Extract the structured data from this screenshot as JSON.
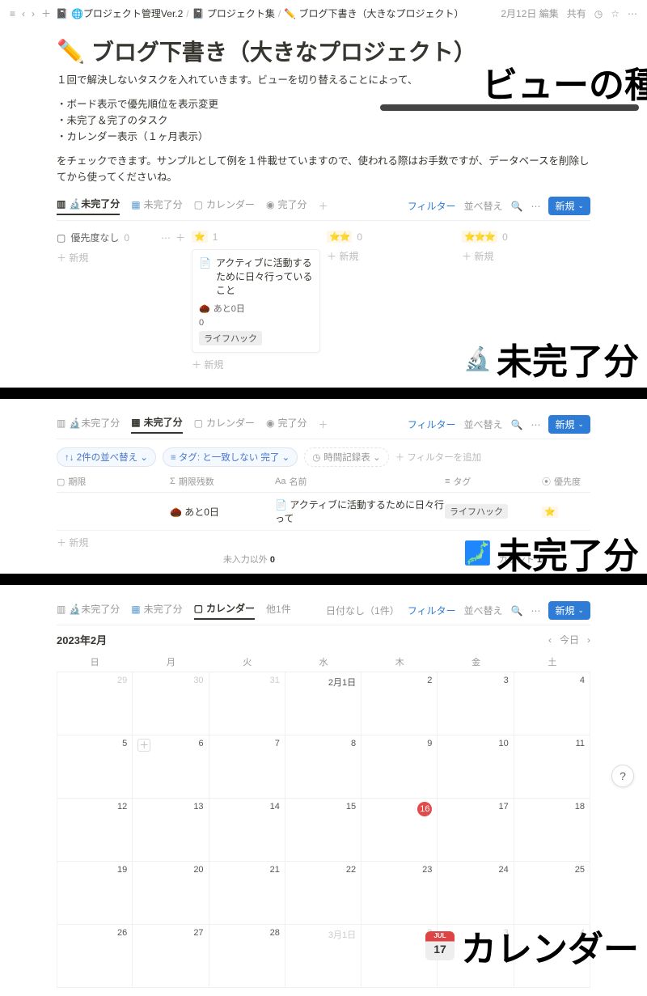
{
  "topbar": {
    "breadcrumb": [
      "🌐プロジェクト管理Ver.2",
      "📓 プロジェクト集",
      "✏️ ブログ下書き（大きなプロジェクト）"
    ],
    "sep": "/",
    "edited": "2月12日 編集",
    "share": "共有"
  },
  "page": {
    "icon": "✏️",
    "title": "ブログ下書き（大きなプロジェクト）",
    "desc": "１回で解決しないタスクを入れていきます。ビューを切り替えることによって、",
    "bullets": [
      "・ボード表示で優先順位を表示変更",
      "・未完了＆完了のタスク",
      "・カレンダー表示（１ヶ月表示）"
    ],
    "desc2": "をチェックできます。サンプルとして例を１件載せていますので、使われる際はお手数ですが、データベースを削除してから使ってくださいね。"
  },
  "annotations": {
    "a1": "ビューの種類",
    "a2": "未完了分",
    "a3": "未完了分",
    "a4": "カレンダー"
  },
  "views": {
    "filter": "フィルター",
    "sort": "並べ替え",
    "new": "新規",
    "add_filter": "＋ フィルターを追加",
    "no_date": "日付なし（1件）"
  },
  "tabs1": [
    "🔬未完了分",
    "未完了分",
    "カレンダー",
    "完了分"
  ],
  "board": {
    "cols": [
      {
        "icon": "▢",
        "label": "優先度なし",
        "count": "0",
        "has_menu": true
      },
      {
        "icon": "⭐",
        "label": "",
        "count": "1"
      },
      {
        "icon": "⭐⭐",
        "label": "",
        "count": "0"
      },
      {
        "icon": "⭐⭐⭐",
        "label": "",
        "count": "0"
      }
    ],
    "card": {
      "title": "アクティブに活動するために日々行っていること",
      "remain": "あと0日",
      "count0": "0",
      "tag": "ライフハック"
    },
    "add": "＋ 新規"
  },
  "tabs2": [
    "🔬未完了分",
    "未完了分",
    "カレンダー",
    "完了分"
  ],
  "filters2": {
    "sort": "↑↓ 2件の並べ替え ⌄",
    "tag": "≡ タグ: と一致しない 完了 ⌄",
    "time": "時間記録表 ⌄"
  },
  "table": {
    "headers": [
      "期限",
      "期限残数",
      "名前",
      "タグ",
      "優先度"
    ],
    "row": {
      "remain": "あと0日",
      "name": "アクティブに活動するために日々行って",
      "tag": "ライフハック"
    },
    "add": "＋ 新規",
    "footer_left": "未入力以外",
    "footer_left_n": "0",
    "footer_right": "カウント",
    "footer_right_n": "1"
  },
  "tabs3": [
    "🔬未完了分",
    "未完了分",
    "カレンダー",
    "他1件"
  ],
  "calendar": {
    "title": "2023年2月",
    "today": "今日",
    "weekdays": [
      "日",
      "月",
      "火",
      "水",
      "木",
      "金",
      "土"
    ],
    "cells": [
      {
        "n": "29",
        "dim": true
      },
      {
        "n": "30",
        "dim": true
      },
      {
        "n": "31",
        "dim": true
      },
      {
        "n": "2月1日"
      },
      {
        "n": "2"
      },
      {
        "n": "3"
      },
      {
        "n": "4"
      },
      {
        "n": "5"
      },
      {
        "n": "6",
        "plus": true
      },
      {
        "n": "7"
      },
      {
        "n": "8"
      },
      {
        "n": "9"
      },
      {
        "n": "10"
      },
      {
        "n": "11"
      },
      {
        "n": "12"
      },
      {
        "n": "13"
      },
      {
        "n": "14"
      },
      {
        "n": "15"
      },
      {
        "n": "16",
        "today": true
      },
      {
        "n": "17"
      },
      {
        "n": "18"
      },
      {
        "n": "19"
      },
      {
        "n": "20"
      },
      {
        "n": "21"
      },
      {
        "n": "22"
      },
      {
        "n": "23"
      },
      {
        "n": "24"
      },
      {
        "n": "25"
      },
      {
        "n": "26"
      },
      {
        "n": "27"
      },
      {
        "n": "28"
      },
      {
        "n": "3月1日",
        "dim": true
      },
      {
        "n": "2",
        "dim": true
      },
      {
        "n": "3",
        "dim": true
      },
      {
        "n": "4",
        "dim": true
      }
    ]
  }
}
